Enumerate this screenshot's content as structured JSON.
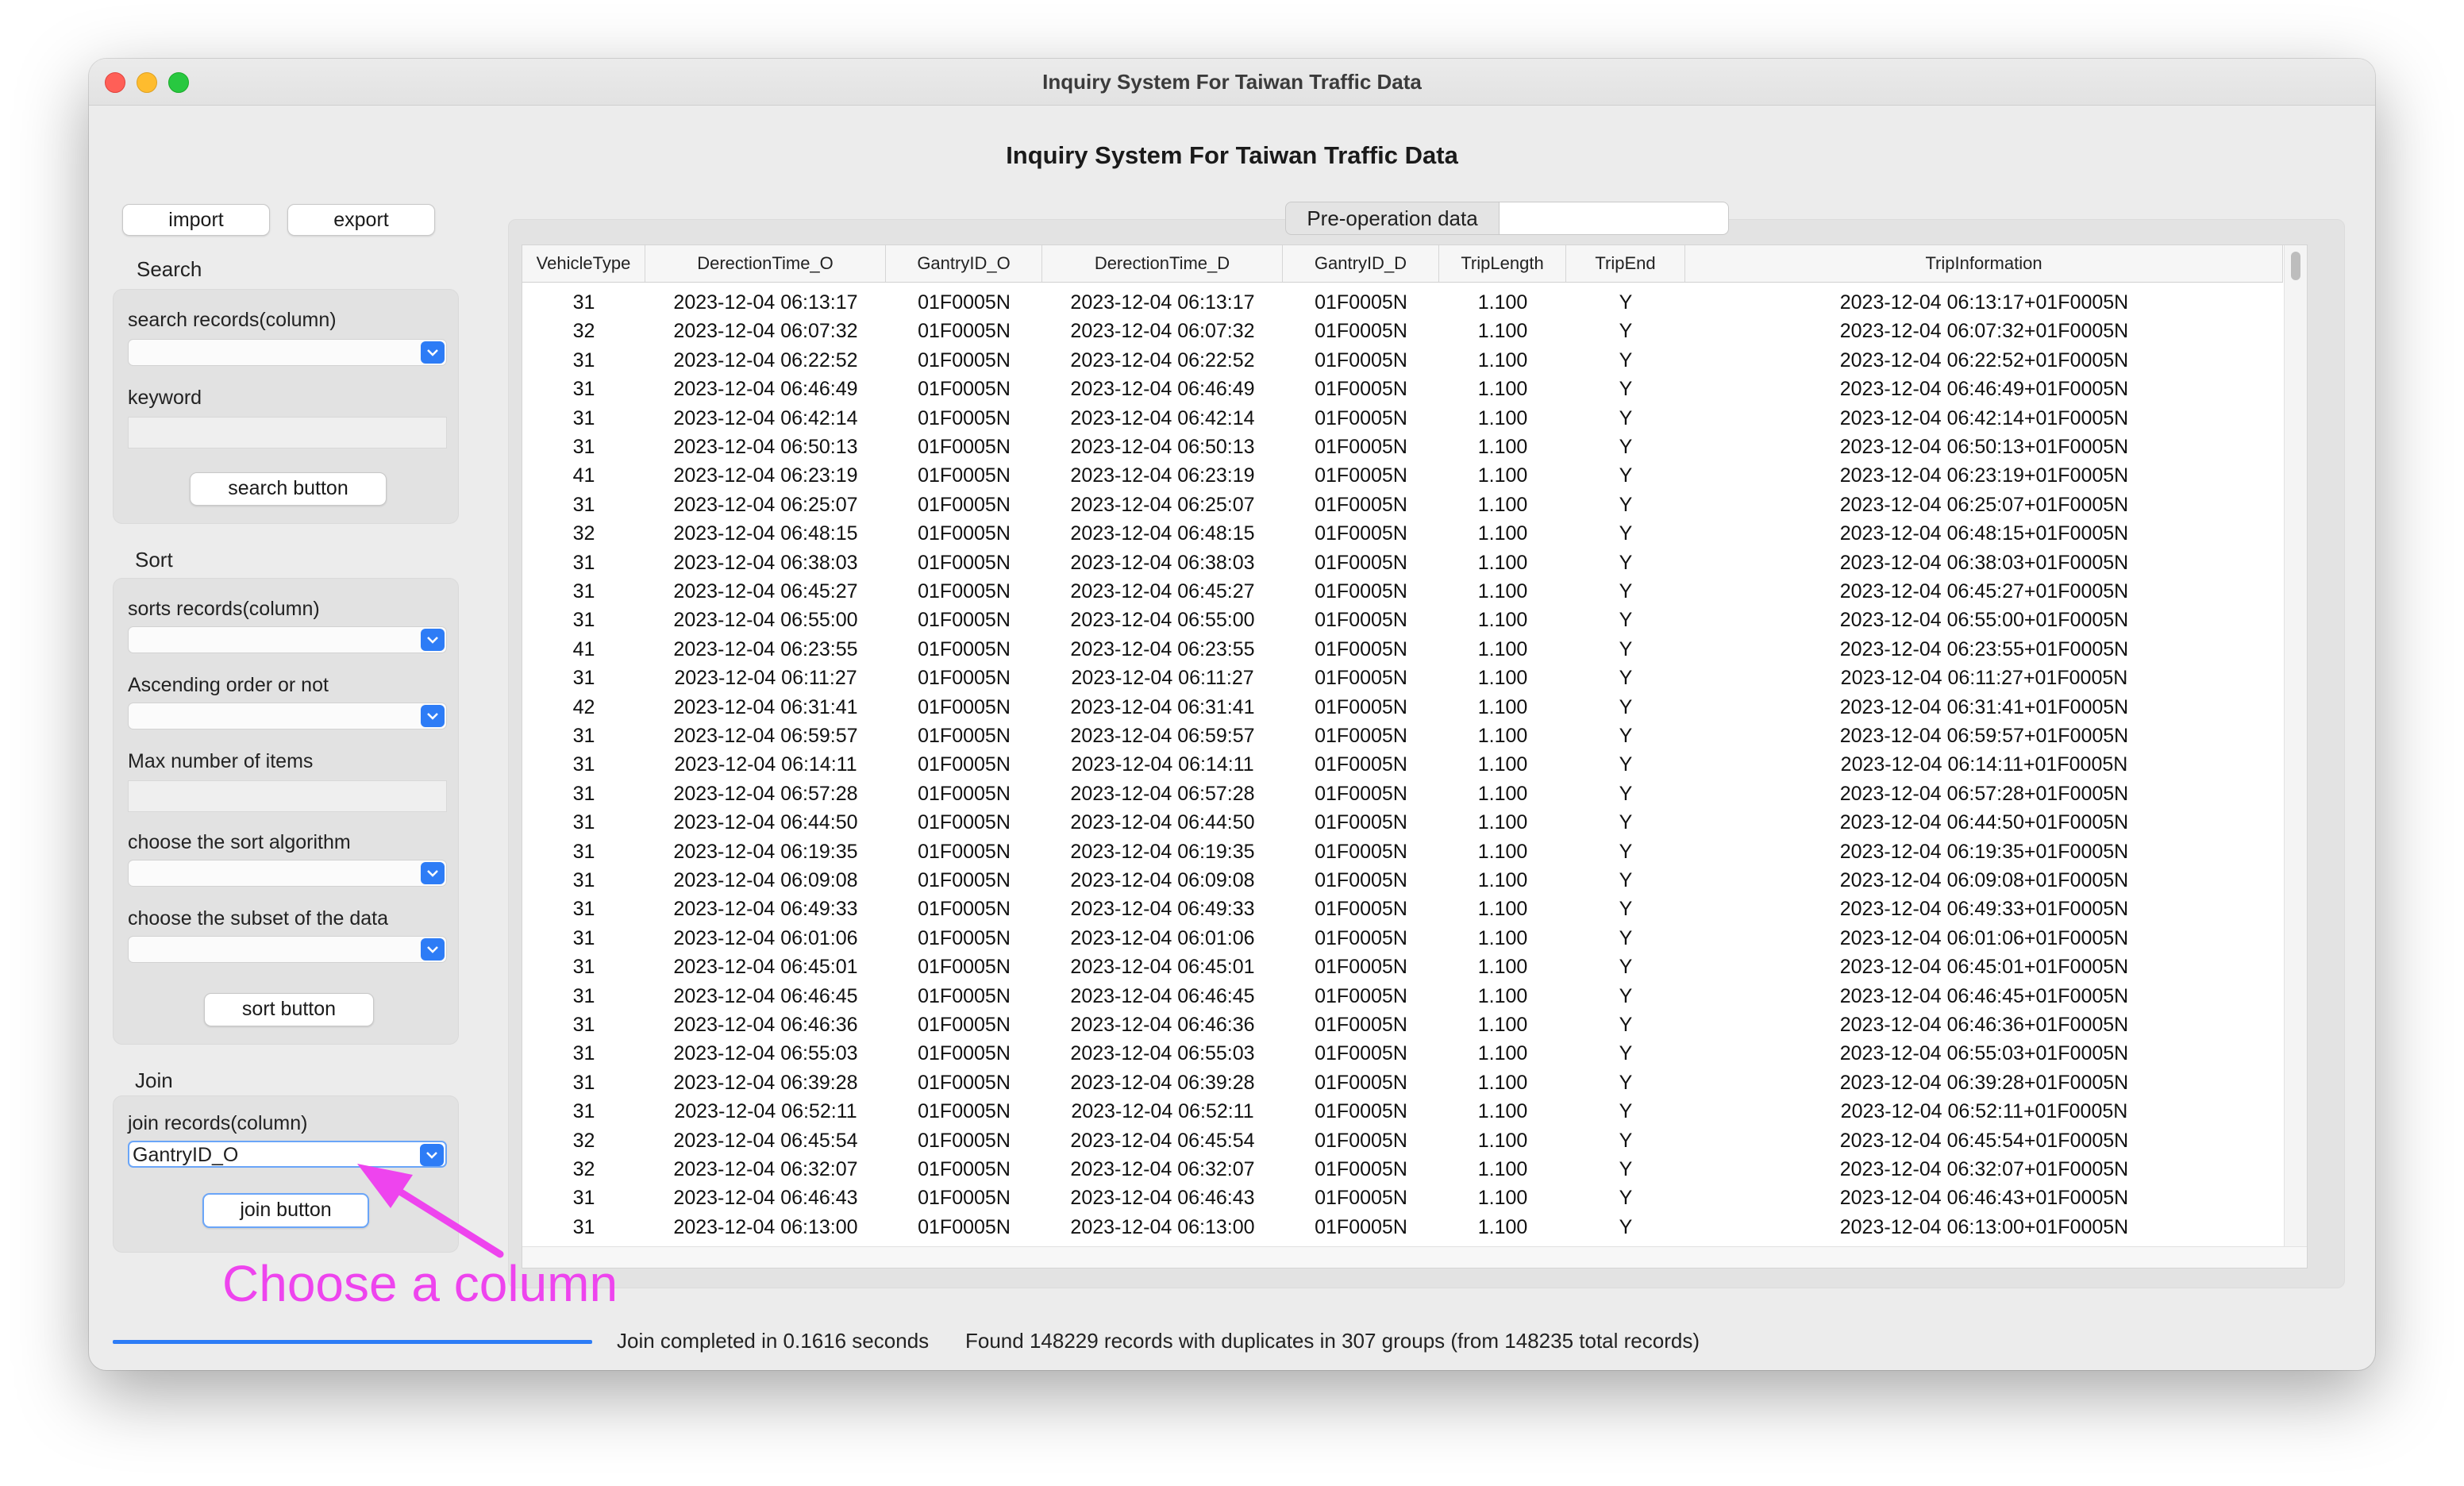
{
  "window": {
    "title": "Inquiry System For Taiwan Traffic Data"
  },
  "app": {
    "title": "Inquiry System For Taiwan Traffic Data"
  },
  "toolbar": {
    "import_label": "import",
    "export_label": "export"
  },
  "search": {
    "section_label": "Search",
    "column_label": "search records(column)",
    "column_value": "",
    "keyword_label": "keyword",
    "keyword_value": "",
    "button_label": "search button"
  },
  "sort": {
    "section_label": "Sort",
    "column_label": "sorts records(column)",
    "column_value": "",
    "ascending_label": "Ascending order or not",
    "ascending_value": "",
    "max_label": "Max number of items",
    "max_value": "",
    "algorithm_label": "choose the sort algorithm",
    "algorithm_value": "",
    "subset_label": "choose the subset of the data",
    "subset_value": "",
    "button_label": "sort button"
  },
  "join": {
    "section_label": "Join",
    "column_label": "join records(column)",
    "column_value": "GantryID_O",
    "button_label": "join button"
  },
  "tabs": {
    "tab1_label": "Pre-operation data",
    "tab2_label": ""
  },
  "table": {
    "columns": [
      "VehicleType",
      "DerectionTime_O",
      "GantryID_O",
      "DerectionTime_D",
      "GantryID_D",
      "TripLength",
      "TripEnd",
      "TripInformation"
    ],
    "rows": [
      [
        "31",
        "2023-12-04 06:13:17",
        "01F0005N",
        "2023-12-04 06:13:17",
        "01F0005N",
        "1.100",
        "Y",
        "2023-12-04 06:13:17+01F0005N"
      ],
      [
        "32",
        "2023-12-04 06:07:32",
        "01F0005N",
        "2023-12-04 06:07:32",
        "01F0005N",
        "1.100",
        "Y",
        "2023-12-04 06:07:32+01F0005N"
      ],
      [
        "31",
        "2023-12-04 06:22:52",
        "01F0005N",
        "2023-12-04 06:22:52",
        "01F0005N",
        "1.100",
        "Y",
        "2023-12-04 06:22:52+01F0005N"
      ],
      [
        "31",
        "2023-12-04 06:46:49",
        "01F0005N",
        "2023-12-04 06:46:49",
        "01F0005N",
        "1.100",
        "Y",
        "2023-12-04 06:46:49+01F0005N"
      ],
      [
        "31",
        "2023-12-04 06:42:14",
        "01F0005N",
        "2023-12-04 06:42:14",
        "01F0005N",
        "1.100",
        "Y",
        "2023-12-04 06:42:14+01F0005N"
      ],
      [
        "31",
        "2023-12-04 06:50:13",
        "01F0005N",
        "2023-12-04 06:50:13",
        "01F0005N",
        "1.100",
        "Y",
        "2023-12-04 06:50:13+01F0005N"
      ],
      [
        "41",
        "2023-12-04 06:23:19",
        "01F0005N",
        "2023-12-04 06:23:19",
        "01F0005N",
        "1.100",
        "Y",
        "2023-12-04 06:23:19+01F0005N"
      ],
      [
        "31",
        "2023-12-04 06:25:07",
        "01F0005N",
        "2023-12-04 06:25:07",
        "01F0005N",
        "1.100",
        "Y",
        "2023-12-04 06:25:07+01F0005N"
      ],
      [
        "32",
        "2023-12-04 06:48:15",
        "01F0005N",
        "2023-12-04 06:48:15",
        "01F0005N",
        "1.100",
        "Y",
        "2023-12-04 06:48:15+01F0005N"
      ],
      [
        "31",
        "2023-12-04 06:38:03",
        "01F0005N",
        "2023-12-04 06:38:03",
        "01F0005N",
        "1.100",
        "Y",
        "2023-12-04 06:38:03+01F0005N"
      ],
      [
        "31",
        "2023-12-04 06:45:27",
        "01F0005N",
        "2023-12-04 06:45:27",
        "01F0005N",
        "1.100",
        "Y",
        "2023-12-04 06:45:27+01F0005N"
      ],
      [
        "31",
        "2023-12-04 06:55:00",
        "01F0005N",
        "2023-12-04 06:55:00",
        "01F0005N",
        "1.100",
        "Y",
        "2023-12-04 06:55:00+01F0005N"
      ],
      [
        "41",
        "2023-12-04 06:23:55",
        "01F0005N",
        "2023-12-04 06:23:55",
        "01F0005N",
        "1.100",
        "Y",
        "2023-12-04 06:23:55+01F0005N"
      ],
      [
        "31",
        "2023-12-04 06:11:27",
        "01F0005N",
        "2023-12-04 06:11:27",
        "01F0005N",
        "1.100",
        "Y",
        "2023-12-04 06:11:27+01F0005N"
      ],
      [
        "42",
        "2023-12-04 06:31:41",
        "01F0005N",
        "2023-12-04 06:31:41",
        "01F0005N",
        "1.100",
        "Y",
        "2023-12-04 06:31:41+01F0005N"
      ],
      [
        "31",
        "2023-12-04 06:59:57",
        "01F0005N",
        "2023-12-04 06:59:57",
        "01F0005N",
        "1.100",
        "Y",
        "2023-12-04 06:59:57+01F0005N"
      ],
      [
        "31",
        "2023-12-04 06:14:11",
        "01F0005N",
        "2023-12-04 06:14:11",
        "01F0005N",
        "1.100",
        "Y",
        "2023-12-04 06:14:11+01F0005N"
      ],
      [
        "31",
        "2023-12-04 06:57:28",
        "01F0005N",
        "2023-12-04 06:57:28",
        "01F0005N",
        "1.100",
        "Y",
        "2023-12-04 06:57:28+01F0005N"
      ],
      [
        "31",
        "2023-12-04 06:44:50",
        "01F0005N",
        "2023-12-04 06:44:50",
        "01F0005N",
        "1.100",
        "Y",
        "2023-12-04 06:44:50+01F0005N"
      ],
      [
        "31",
        "2023-12-04 06:19:35",
        "01F0005N",
        "2023-12-04 06:19:35",
        "01F0005N",
        "1.100",
        "Y",
        "2023-12-04 06:19:35+01F0005N"
      ],
      [
        "31",
        "2023-12-04 06:09:08",
        "01F0005N",
        "2023-12-04 06:09:08",
        "01F0005N",
        "1.100",
        "Y",
        "2023-12-04 06:09:08+01F0005N"
      ],
      [
        "31",
        "2023-12-04 06:49:33",
        "01F0005N",
        "2023-12-04 06:49:33",
        "01F0005N",
        "1.100",
        "Y",
        "2023-12-04 06:49:33+01F0005N"
      ],
      [
        "31",
        "2023-12-04 06:01:06",
        "01F0005N",
        "2023-12-04 06:01:06",
        "01F0005N",
        "1.100",
        "Y",
        "2023-12-04 06:01:06+01F0005N"
      ],
      [
        "31",
        "2023-12-04 06:45:01",
        "01F0005N",
        "2023-12-04 06:45:01",
        "01F0005N",
        "1.100",
        "Y",
        "2023-12-04 06:45:01+01F0005N"
      ],
      [
        "31",
        "2023-12-04 06:46:45",
        "01F0005N",
        "2023-12-04 06:46:45",
        "01F0005N",
        "1.100",
        "Y",
        "2023-12-04 06:46:45+01F0005N"
      ],
      [
        "31",
        "2023-12-04 06:46:36",
        "01F0005N",
        "2023-12-04 06:46:36",
        "01F0005N",
        "1.100",
        "Y",
        "2023-12-04 06:46:36+01F0005N"
      ],
      [
        "31",
        "2023-12-04 06:55:03",
        "01F0005N",
        "2023-12-04 06:55:03",
        "01F0005N",
        "1.100",
        "Y",
        "2023-12-04 06:55:03+01F0005N"
      ],
      [
        "31",
        "2023-12-04 06:39:28",
        "01F0005N",
        "2023-12-04 06:39:28",
        "01F0005N",
        "1.100",
        "Y",
        "2023-12-04 06:39:28+01F0005N"
      ],
      [
        "31",
        "2023-12-04 06:52:11",
        "01F0005N",
        "2023-12-04 06:52:11",
        "01F0005N",
        "1.100",
        "Y",
        "2023-12-04 06:52:11+01F0005N"
      ],
      [
        "32",
        "2023-12-04 06:45:54",
        "01F0005N",
        "2023-12-04 06:45:54",
        "01F0005N",
        "1.100",
        "Y",
        "2023-12-04 06:45:54+01F0005N"
      ],
      [
        "32",
        "2023-12-04 06:32:07",
        "01F0005N",
        "2023-12-04 06:32:07",
        "01F0005N",
        "1.100",
        "Y",
        "2023-12-04 06:32:07+01F0005N"
      ],
      [
        "31",
        "2023-12-04 06:46:43",
        "01F0005N",
        "2023-12-04 06:46:43",
        "01F0005N",
        "1.100",
        "Y",
        "2023-12-04 06:46:43+01F0005N"
      ],
      [
        "31",
        "2023-12-04 06:13:00",
        "01F0005N",
        "2023-12-04 06:13:00",
        "01F0005N",
        "1.100",
        "Y",
        "2023-12-04 06:13:00+01F0005N"
      ]
    ]
  },
  "status": {
    "progress": 1.0,
    "join_time": "Join completed in 0.1616 seconds",
    "result": "Found 148229 records with duplicates in 307 groups (from 148235 total records)"
  },
  "annotation": {
    "text": "Choose a column",
    "color": "#ee44ee"
  },
  "icons": {
    "combo_arrow": "chevron-down-icon",
    "annotation_arrow": "arrow-icon"
  }
}
